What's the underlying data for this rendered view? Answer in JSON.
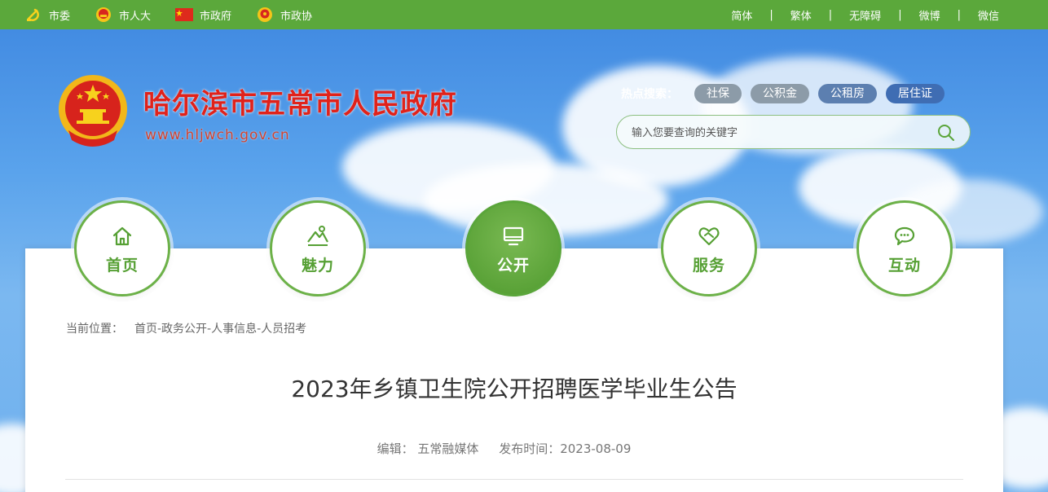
{
  "topbar": {
    "links": [
      {
        "label": "市委",
        "icon": "party-emblem-icon"
      },
      {
        "label": "市人大",
        "icon": "national-emblem-icon"
      },
      {
        "label": "市政府",
        "icon": "national-flag-icon"
      },
      {
        "label": "市政协",
        "icon": "cppcc-emblem-icon"
      }
    ],
    "right_links": [
      "简体",
      "繁体",
      "无障碍",
      "微博",
      "微信"
    ],
    "separator": "|"
  },
  "header": {
    "title": "哈尔滨市五常市人民政府",
    "url": "www.hljwch.gov.cn",
    "hot_label": "热点搜索：",
    "hot_tags": [
      "社保",
      "公积金",
      "公租房",
      "居住证"
    ],
    "search_placeholder": "输入您要查询的关键字"
  },
  "nav": [
    {
      "label": "首页",
      "icon": "home-icon",
      "active": false
    },
    {
      "label": "魅力",
      "icon": "landscape-icon",
      "active": false
    },
    {
      "label": "公开",
      "icon": "monitor-icon",
      "active": true
    },
    {
      "label": "服务",
      "icon": "heart-service-icon",
      "active": false
    },
    {
      "label": "互动",
      "icon": "chat-icon",
      "active": false
    }
  ],
  "breadcrumb": {
    "label": "当前位置：",
    "path": "首页-政务公开-人事信息-人员招考"
  },
  "article": {
    "title": "2023年乡镇卫生院公开招聘医学毕业生公告",
    "editor": "编辑：  五常融媒体",
    "date": "发布时间：2023-08-09"
  },
  "colors": {
    "topbar_green": "#5ba83b",
    "title_red": "#e0221b",
    "nav_green": "#56a034"
  }
}
